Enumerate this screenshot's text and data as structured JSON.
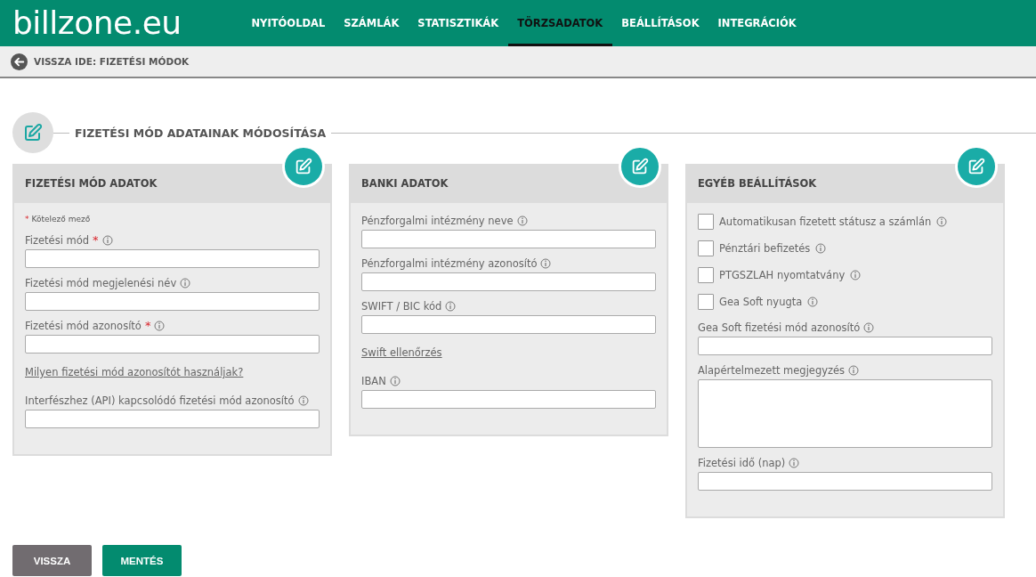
{
  "header": {
    "logo": "billzone.eu",
    "nav": [
      {
        "label": "NYITÓOLDAL",
        "selected": false
      },
      {
        "label": "SZÁMLÁK",
        "selected": false
      },
      {
        "label": "STATISZTIKÁK",
        "selected": false
      },
      {
        "label": "TÖRZSADATOK",
        "selected": true
      },
      {
        "label": "BEÁLLÍTÁSOK",
        "selected": false
      },
      {
        "label": "INTEGRÁCIÓK",
        "selected": false
      }
    ]
  },
  "back_bar": {
    "label": "VISSZA IDE: FIZETÉSI MÓDOK"
  },
  "section_title": "FIZETÉSI MÓD ADATAINAK MÓDOSÍTÁSA",
  "panels": [
    {
      "title": "FIZETÉSI MÓD ADATOK",
      "items": [
        {
          "kind": "note",
          "mark": "*",
          "label": "Kötelező mező"
        },
        {
          "kind": "field",
          "label": "Fizetési mód",
          "required": true
        },
        {
          "kind": "field",
          "label": "Fizetési mód megjelenési név",
          "required": false
        },
        {
          "kind": "field",
          "label": "Fizetési mód azonosító",
          "required": true
        },
        {
          "kind": "link",
          "label": "Milyen fizetési mód azonosítót használjak?"
        },
        {
          "kind": "field",
          "label": "Interfészhez (API) kapcsolódó fizetési mód azonosító",
          "required": false
        }
      ]
    },
    {
      "title": "BANKI ADATOK",
      "items": [
        {
          "kind": "field",
          "label": "Pénzforgalmi intézmény neve",
          "required": false
        },
        {
          "kind": "field",
          "label": "Pénzforgalmi intézmény azonosító",
          "required": false
        },
        {
          "kind": "field",
          "label": "SWIFT / BIC kód",
          "required": false
        },
        {
          "kind": "link",
          "label": "Swift ellenőrzés"
        },
        {
          "kind": "field",
          "label": "IBAN",
          "required": false
        }
      ]
    },
    {
      "title": "EGYÉB BEÁLLÍTÁSOK",
      "items": [
        {
          "kind": "checkbox",
          "label": "Automatikusan fizetett státusz a számlán",
          "checked": false
        },
        {
          "kind": "checkbox",
          "label": "Pénztári befizetés",
          "checked": false
        },
        {
          "kind": "checkbox",
          "label": "PTGSZLAH nyomtatvány",
          "checked": false
        },
        {
          "kind": "checkbox",
          "label": "Gea Soft nyugta",
          "checked": false
        },
        {
          "kind": "field",
          "label": "Gea Soft fizetési mód azonosító",
          "required": false
        },
        {
          "kind": "textarea",
          "label": "Alapértelmezett megjegyzés",
          "required": false
        },
        {
          "kind": "field",
          "label": "Fizetési idő (nap)",
          "required": false
        }
      ]
    }
  ],
  "buttons": [
    {
      "label": "VISSZA",
      "kind": "secondary"
    },
    {
      "label": "MENTÉS",
      "kind": "primary"
    }
  ]
}
